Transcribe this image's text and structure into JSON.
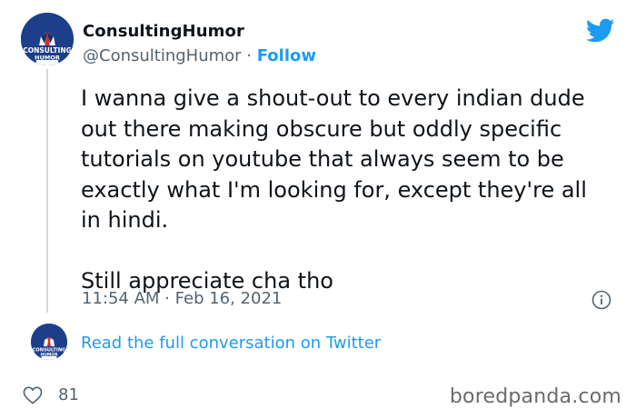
{
  "tweet": {
    "author_name": "ConsultingHumor",
    "author_handle": "@ConsultingHumor",
    "separator": " · ",
    "follow_label": "Follow",
    "avatar_text_line1": "CONSULTING",
    "avatar_text_line2": "HUMOR",
    "body_paragraph_1": "I wanna give a shout-out to every indian dude out there making obscure but oddly specific tutorials on youtube that always seem to be exactly what I'm looking for, except they're all in hindi.",
    "body_paragraph_2": "Still appreciate cha tho",
    "time": "11:54 AM",
    "date": "Feb 16, 2021",
    "read_link": "Read the full conversation on Twitter",
    "like_count": "81"
  },
  "watermark": "boredpanda.com",
  "icons": {
    "brand": "twitter-bird-icon",
    "info": "info-icon",
    "like": "heart-icon"
  },
  "colors": {
    "link": "#1d9bf0",
    "muted": "#536471",
    "avatar_bg": "#1d3f8a"
  }
}
